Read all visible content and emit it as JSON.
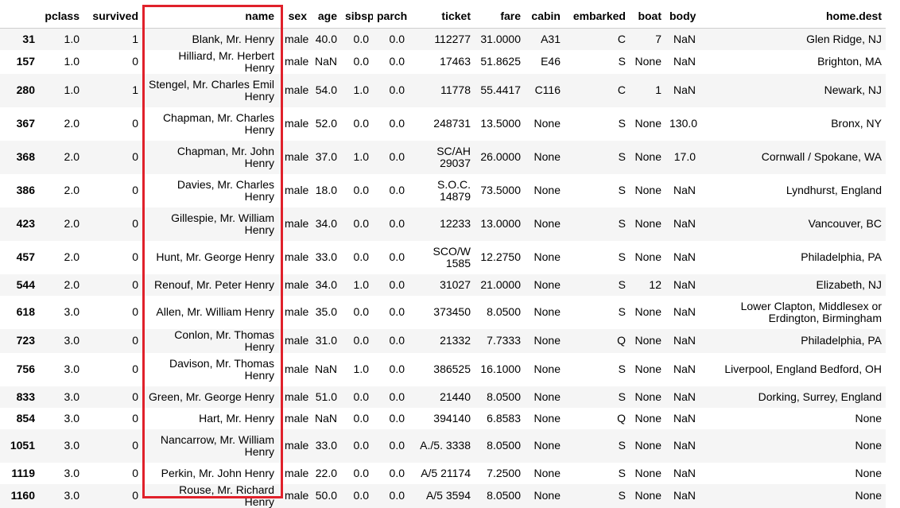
{
  "table": {
    "columns": [
      "",
      "pclass",
      "survived",
      "name",
      "sex",
      "age",
      "sibsp",
      "parch",
      "ticket",
      "fare",
      "cabin",
      "embarked",
      "boat",
      "body",
      "home.dest"
    ],
    "rows": [
      [
        "31",
        "1.0",
        "1",
        "Blank, Mr. Henry",
        "male",
        "40.0",
        "0.0",
        "0.0",
        "112277",
        "31.0000",
        "A31",
        "C",
        "7",
        "NaN",
        "Glen Ridge, NJ"
      ],
      [
        "157",
        "1.0",
        "0",
        "Hilliard, Mr. Herbert Henry",
        "male",
        "NaN",
        "0.0",
        "0.0",
        "17463",
        "51.8625",
        "E46",
        "S",
        "None",
        "NaN",
        "Brighton, MA"
      ],
      [
        "280",
        "1.0",
        "1",
        "Stengel, Mr. Charles Emil Henry",
        "male",
        "54.0",
        "1.0",
        "0.0",
        "11778",
        "55.4417",
        "C116",
        "C",
        "1",
        "NaN",
        "Newark, NJ"
      ],
      [
        "367",
        "2.0",
        "0",
        "Chapman, Mr. Charles Henry",
        "male",
        "52.0",
        "0.0",
        "0.0",
        "248731",
        "13.5000",
        "None",
        "S",
        "None",
        "130.0",
        "Bronx, NY"
      ],
      [
        "368",
        "2.0",
        "0",
        "Chapman, Mr. John Henry",
        "male",
        "37.0",
        "1.0",
        "0.0",
        "SC/AH 29037",
        "26.0000",
        "None",
        "S",
        "None",
        "17.0",
        "Cornwall / Spokane, WA"
      ],
      [
        "386",
        "2.0",
        "0",
        "Davies, Mr. Charles Henry",
        "male",
        "18.0",
        "0.0",
        "0.0",
        "S.O.C. 14879",
        "73.5000",
        "None",
        "S",
        "None",
        "NaN",
        "Lyndhurst, England"
      ],
      [
        "423",
        "2.0",
        "0",
        "Gillespie, Mr. William Henry",
        "male",
        "34.0",
        "0.0",
        "0.0",
        "12233",
        "13.0000",
        "None",
        "S",
        "None",
        "NaN",
        "Vancouver, BC"
      ],
      [
        "457",
        "2.0",
        "0",
        "Hunt, Mr. George Henry",
        "male",
        "33.0",
        "0.0",
        "0.0",
        "SCO/W 1585",
        "12.2750",
        "None",
        "S",
        "None",
        "NaN",
        "Philadelphia, PA"
      ],
      [
        "544",
        "2.0",
        "0",
        "Renouf, Mr. Peter Henry",
        "male",
        "34.0",
        "1.0",
        "0.0",
        "31027",
        "21.0000",
        "None",
        "S",
        "12",
        "NaN",
        "Elizabeth, NJ"
      ],
      [
        "618",
        "3.0",
        "0",
        "Allen, Mr. William Henry",
        "male",
        "35.0",
        "0.0",
        "0.0",
        "373450",
        "8.0500",
        "None",
        "S",
        "None",
        "NaN",
        "Lower Clapton, Middlesex or Erdington, Birmingham"
      ],
      [
        "723",
        "3.0",
        "0",
        "Conlon, Mr. Thomas Henry",
        "male",
        "31.0",
        "0.0",
        "0.0",
        "21332",
        "7.7333",
        "None",
        "Q",
        "None",
        "NaN",
        "Philadelphia, PA"
      ],
      [
        "756",
        "3.0",
        "0",
        "Davison, Mr. Thomas Henry",
        "male",
        "NaN",
        "1.0",
        "0.0",
        "386525",
        "16.1000",
        "None",
        "S",
        "None",
        "NaN",
        "Liverpool, England Bedford, OH"
      ],
      [
        "833",
        "3.0",
        "0",
        "Green, Mr. George Henry",
        "male",
        "51.0",
        "0.0",
        "0.0",
        "21440",
        "8.0500",
        "None",
        "S",
        "None",
        "NaN",
        "Dorking, Surrey, England"
      ],
      [
        "854",
        "3.0",
        "0",
        "Hart, Mr. Henry",
        "male",
        "NaN",
        "0.0",
        "0.0",
        "394140",
        "6.8583",
        "None",
        "Q",
        "None",
        "NaN",
        "None"
      ],
      [
        "1051",
        "3.0",
        "0",
        "Nancarrow, Mr. William Henry",
        "male",
        "33.0",
        "0.0",
        "0.0",
        "A./5. 3338",
        "8.0500",
        "None",
        "S",
        "None",
        "NaN",
        "None"
      ],
      [
        "1119",
        "3.0",
        "0",
        "Perkin, Mr. John Henry",
        "male",
        "22.0",
        "0.0",
        "0.0",
        "A/5 21174",
        "7.2500",
        "None",
        "S",
        "None",
        "NaN",
        "None"
      ],
      [
        "1160",
        "3.0",
        "0",
        "Rouse, Mr. Richard Henry",
        "male",
        "50.0",
        "0.0",
        "0.0",
        "A/5 3594",
        "8.0500",
        "None",
        "S",
        "None",
        "NaN",
        "None"
      ]
    ]
  },
  "highlight": {
    "column": "name",
    "color": "#e0212b"
  }
}
